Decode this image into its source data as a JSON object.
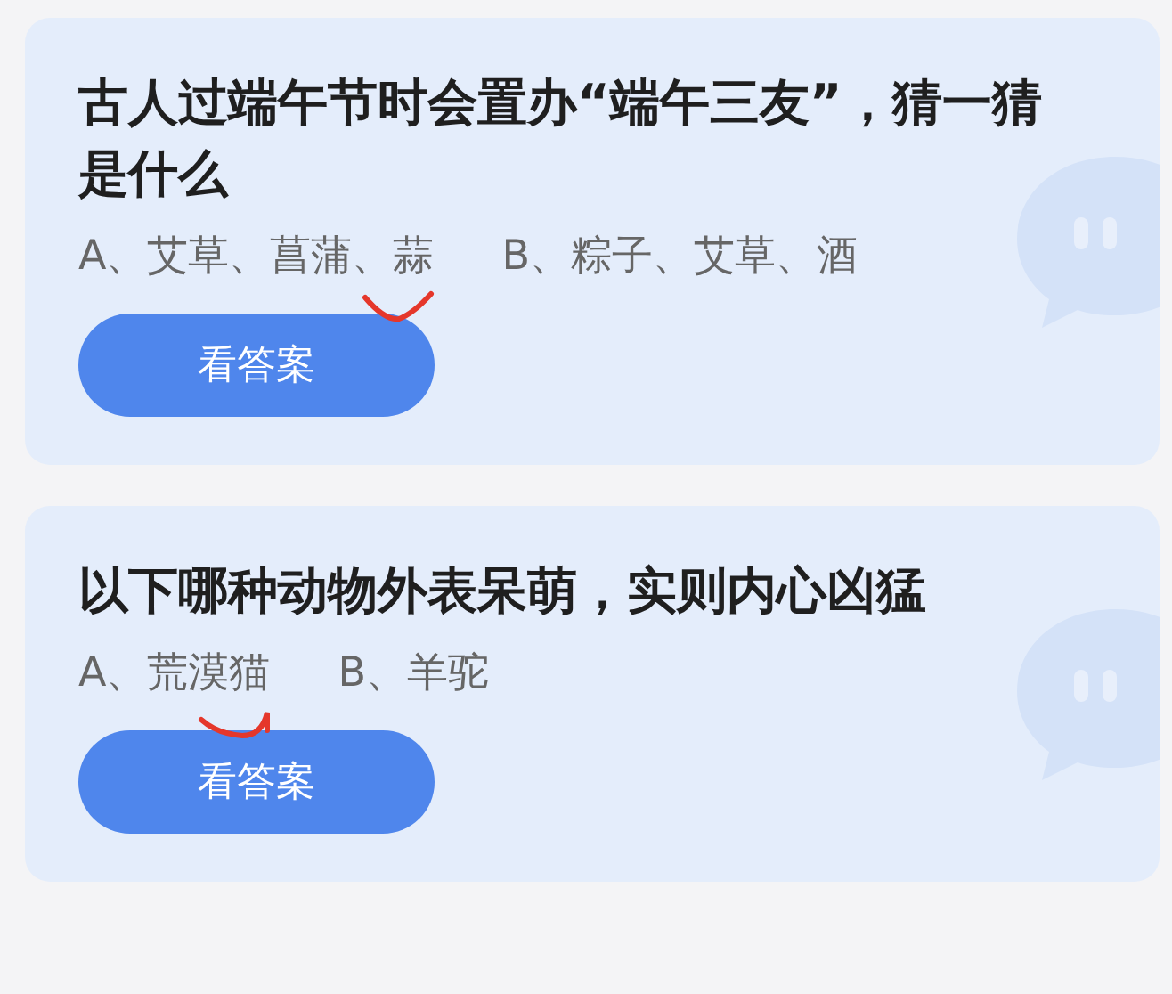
{
  "cards": [
    {
      "question": "古人过端午节时会置办“端午三友”，猜一猜是什么",
      "options": [
        {
          "text": "A、艾草、菖蒲、蒜",
          "marked": true
        },
        {
          "text": "B、粽子、艾草、酒",
          "marked": false
        }
      ],
      "button": "看答案"
    },
    {
      "question": "以下哪种动物外表呆萌，实则内心凶猛",
      "options": [
        {
          "text": "A、荒漠猫",
          "marked": true
        },
        {
          "text": "B、羊驼",
          "marked": false
        }
      ],
      "button": "看答案"
    }
  ]
}
